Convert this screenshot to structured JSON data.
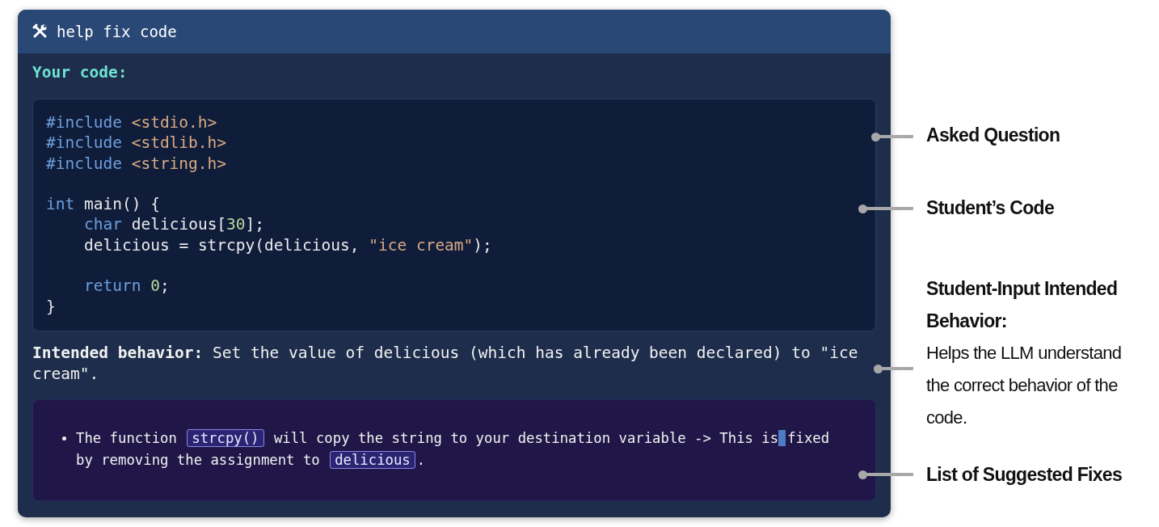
{
  "panel": {
    "title": "help fix code",
    "code_heading": "Your code:",
    "code_lines": [
      {
        "indented": false,
        "space_before": false,
        "tokens": [
          {
            "kind": "directive",
            "text": "#include"
          },
          {
            "kind": "path",
            "text": " <stdio.h>"
          }
        ]
      },
      {
        "indented": false,
        "space_before": false,
        "tokens": [
          {
            "kind": "directive",
            "text": "#include"
          },
          {
            "kind": "path",
            "text": " <stdlib.h>"
          }
        ]
      },
      {
        "indented": false,
        "space_before": false,
        "tokens": [
          {
            "kind": "directive",
            "text": "#include"
          },
          {
            "kind": "path",
            "text": " <string.h>"
          }
        ]
      },
      {
        "indented": false,
        "space_before": true,
        "tokens": [
          {
            "kind": "keyword",
            "text": "int"
          },
          {
            "kind": "plain",
            "text": " main() {"
          }
        ]
      },
      {
        "indented": true,
        "space_before": false,
        "tokens": [
          {
            "kind": "keyword",
            "text": "char"
          },
          {
            "kind": "plain",
            "text": " delicious["
          },
          {
            "kind": "number",
            "text": "30"
          },
          {
            "kind": "plain",
            "text": "];"
          }
        ]
      },
      {
        "indented": true,
        "space_before": false,
        "tokens": [
          {
            "kind": "plain",
            "text": "delicious = strcpy(delicious, "
          },
          {
            "kind": "string",
            "text": "\"ice cream\""
          },
          {
            "kind": "plain",
            "text": ");"
          }
        ]
      },
      {
        "indented": true,
        "space_before": true,
        "tokens": [
          {
            "kind": "keyword",
            "text": "return"
          },
          {
            "kind": "number",
            "text": " 0"
          },
          {
            "kind": "plain",
            "text": ";"
          }
        ]
      },
      {
        "indented": false,
        "space_before": false,
        "tokens": [
          {
            "kind": "plain",
            "text": "}"
          }
        ]
      }
    ],
    "intended_behavior": "**Intended behavior:** Set the value of delicious (which has already been declared) to \"ice cream\".",
    "fixes": [
      {
        "segments": [
          {
            "kind": "text",
            "text": "The function "
          },
          {
            "kind": "code",
            "text": "strcpy()"
          },
          {
            "kind": "text",
            "text": " will copy the string to your destination variable -> This is"
          },
          {
            "kind": "cursor"
          },
          {
            "kind": "text",
            "text": "fixed by removing the assignment to "
          },
          {
            "kind": "code",
            "text": "delicious"
          },
          {
            "kind": "text",
            "text": "."
          }
        ]
      }
    ]
  },
  "annotations": [
    {
      "title": "Asked Question"
    },
    {
      "title": "Student’s Code"
    },
    {
      "title": "Student-Input Intended Behavior:",
      "body": "Helps the LLM understand the correct behavior of the code."
    },
    {
      "title": "List of Suggested Fixes"
    }
  ]
}
